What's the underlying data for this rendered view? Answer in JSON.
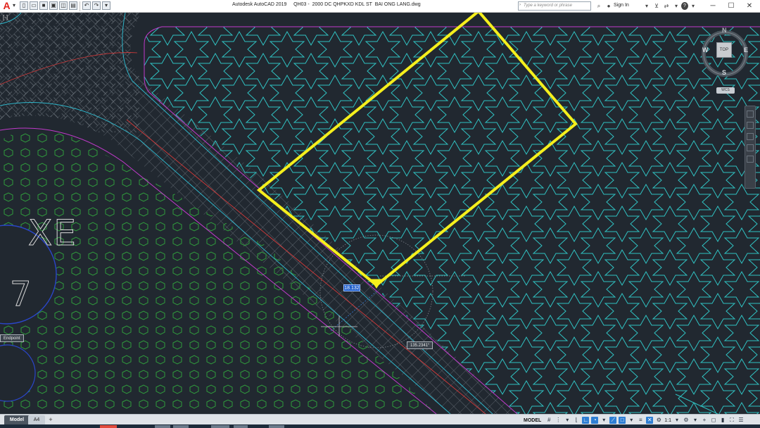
{
  "titlebar": {
    "app_logo": "A",
    "title": "Autodesk AutoCAD 2019     QH03 -  2000 DC QHPKXD KDL ST  BAI ONG LANG.dwg",
    "search_placeholder": "Type a keyword or phrase",
    "signin_label": "Sign In",
    "help_label": "?",
    "window_controls": [
      "─",
      "☐",
      "✕"
    ]
  },
  "canvas": {
    "viewport_label": "[-]",
    "dim_input_value": "18.132",
    "snap_tooltip": "Endpoint",
    "angle_tooltip": "135.2341°",
    "hatch_text": "XE",
    "hatch_number": "7"
  },
  "viewcube": {
    "top_label": "TOP",
    "north": "N",
    "south": "S",
    "east": "E",
    "west": "W",
    "wcs_label": "WCS"
  },
  "bottom": {
    "tabs": [
      "Model",
      "A4"
    ],
    "add_tab": "+",
    "model_status": "MODEL",
    "scale": "1:1"
  },
  "colors": {
    "background": "#212830",
    "highlight": "#f5ef1c",
    "star_hatch": "#2fc2c2",
    "hex_hatch": "#2f9b3c",
    "boundary": "#c13acb",
    "centerline": "#d63a3a"
  }
}
